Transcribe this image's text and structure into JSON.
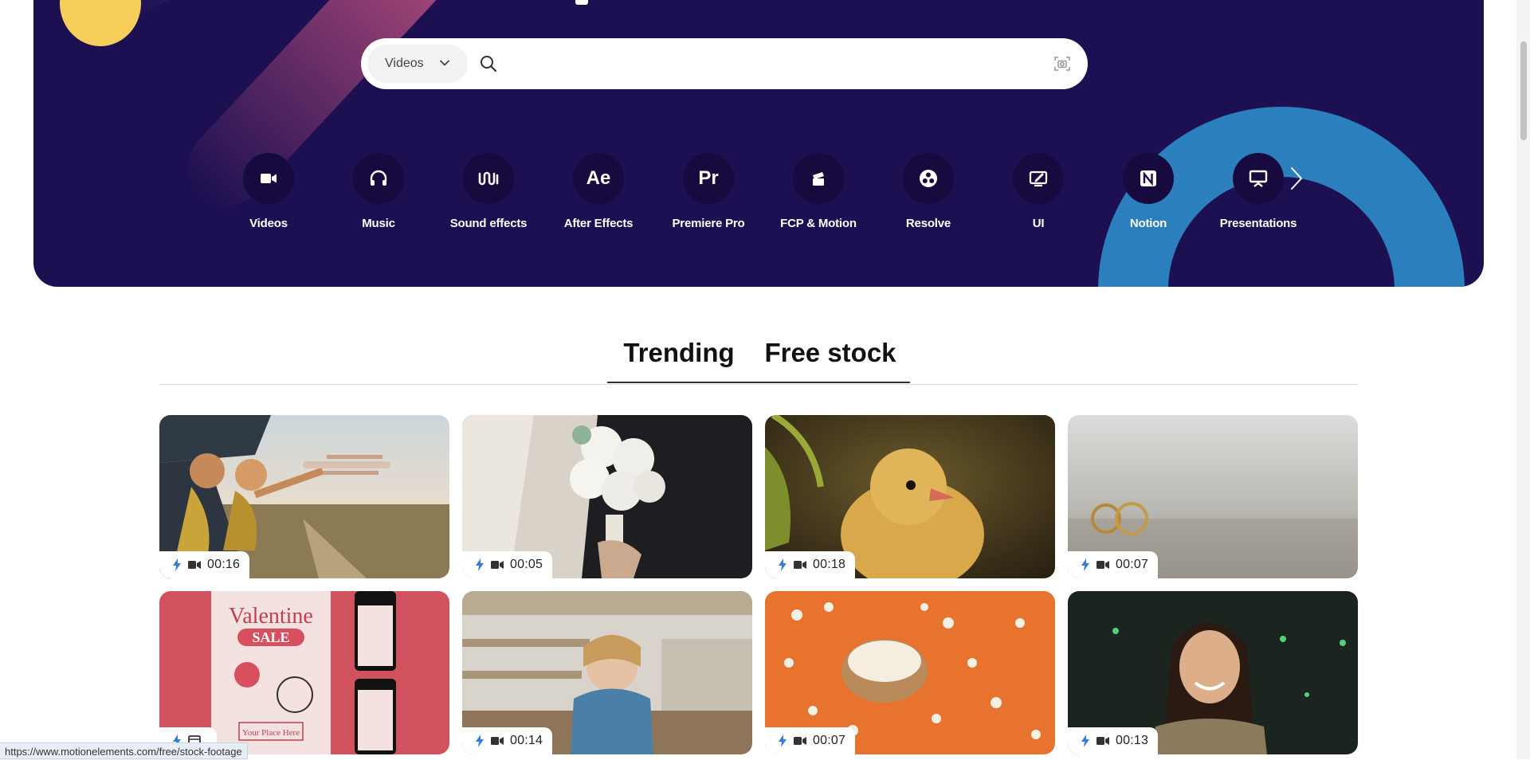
{
  "search": {
    "type_selected": "Videos",
    "placeholder": "",
    "value": ""
  },
  "categories": [
    {
      "label": "Videos",
      "icon": "video-camera-icon"
    },
    {
      "label": "Music",
      "icon": "headphones-icon"
    },
    {
      "label": "Sound effects",
      "icon": "sound-wave-icon"
    },
    {
      "label": "After Effects",
      "icon": "after-effects-icon",
      "glyph": "Ae"
    },
    {
      "label": "Premiere Pro",
      "icon": "premiere-pro-icon",
      "glyph": "Pr"
    },
    {
      "label": "FCP & Motion",
      "icon": "clapper-icon"
    },
    {
      "label": "Resolve",
      "icon": "resolve-icon"
    },
    {
      "label": "UI",
      "icon": "ui-edit-icon"
    },
    {
      "label": "Notion",
      "icon": "notion-icon"
    },
    {
      "label": "Presentations",
      "icon": "presentation-icon"
    }
  ],
  "tabs": [
    {
      "label": "Trending"
    },
    {
      "label": "Free stock"
    }
  ],
  "cards": [
    {
      "duration": "00:16",
      "scene": "kids-with-toy-plane"
    },
    {
      "duration": "00:05",
      "scene": "bridal-bouquet"
    },
    {
      "duration": "00:18",
      "scene": "yellow-chick"
    },
    {
      "duration": "00:07",
      "scene": "gold-rings"
    },
    {
      "duration": "",
      "scene": "valentine-sale-template",
      "poster_text_1": "Valentine",
      "poster_text_2": "SALE",
      "poster_text_3": "Your Place Here"
    },
    {
      "duration": "00:14",
      "scene": "girl-at-table"
    },
    {
      "duration": "00:07",
      "scene": "popcorn-on-orange"
    },
    {
      "duration": "00:13",
      "scene": "smiling-woman-night"
    }
  ],
  "status_url": "https://www.motionelements.com/free/stock-footage",
  "colors": {
    "hero_bg": "#1d1052",
    "bubble_bg": "#160a3e",
    "ring": "#2b7fbd",
    "yellow": "#f6cf5a",
    "accent_icon": "#3a7bd5"
  }
}
